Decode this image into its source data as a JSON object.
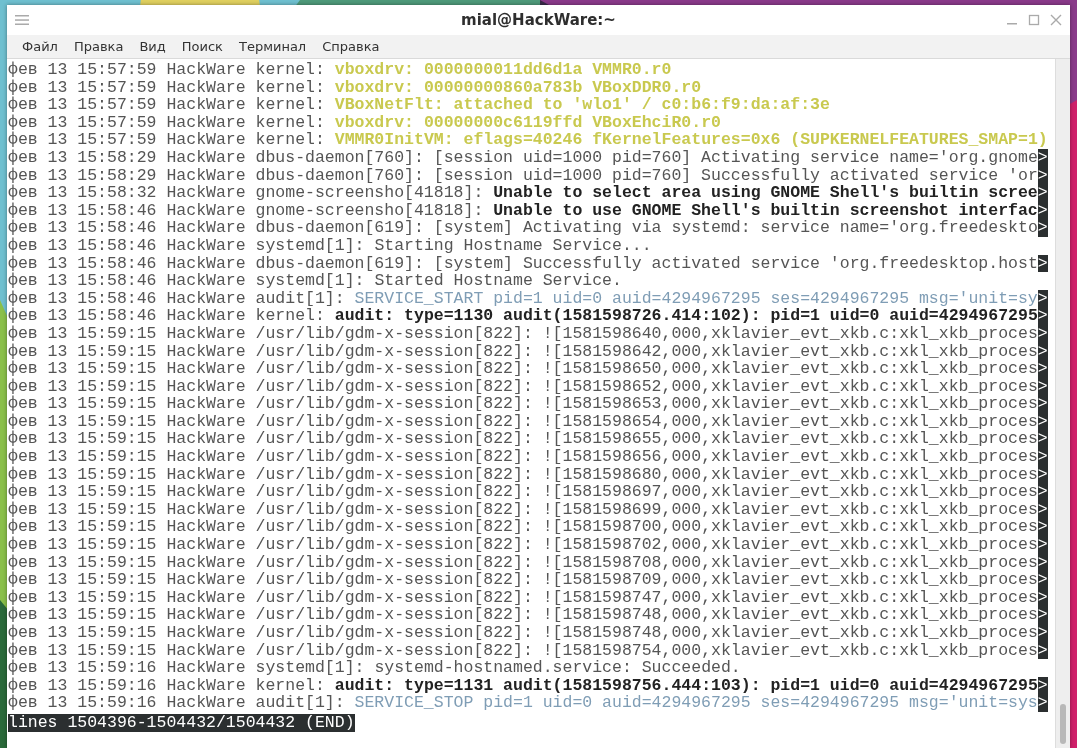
{
  "window": {
    "title": "mial@HackWare:~"
  },
  "menu": [
    "Файл",
    "Правка",
    "Вид",
    "Поиск",
    "Терминал",
    "Справка"
  ],
  "log": [
    {
      "prefix": "фев 13 15:57:59 HackWare kernel:",
      "message": "vboxdrv: 0000000011dd6d1a VMMR0.r0",
      "kind": "highlight"
    },
    {
      "prefix": "фев 13 15:57:59 HackWare kernel:",
      "message": "vboxdrv: 00000000860a783b VBoxDDR0.r0",
      "kind": "highlight"
    },
    {
      "prefix": "фев 13 15:57:59 HackWare kernel:",
      "message": "VBoxNetFlt: attached to 'wlo1' / c0:b6:f9:da:af:3e",
      "kind": "highlight"
    },
    {
      "prefix": "фев 13 15:57:59 HackWare kernel:",
      "message": "vboxdrv: 00000000c6119ffd VBoxEhciR0.r0",
      "kind": "highlight"
    },
    {
      "prefix": "фев 13 15:57:59 HackWare kernel:",
      "message": "VMMR0InitVM: eflags=40246 fKernelFeatures=0x6 (SUPKERNELFEATURES_SMAP=1)",
      "kind": "highlight"
    },
    {
      "prefix": "фев 13 15:58:29 HackWare dbus-daemon[760]:",
      "message": "[session uid=1000 pid=760] Activating service name='org.gnome",
      "kind": "plain",
      "more": ">"
    },
    {
      "prefix": "фев 13 15:58:29 HackWare dbus-daemon[760]:",
      "message": "[session uid=1000 pid=760] Successfully activated service 'or",
      "kind": "plain",
      "more": ">"
    },
    {
      "prefix": "фев 13 15:58:32 HackWare gnome-screensho[41818]:",
      "message": "Unable to select area using GNOME Shell's builtin scree",
      "kind": "bold",
      "more": ">"
    },
    {
      "prefix": "фев 13 15:58:46 HackWare gnome-screensho[41818]:",
      "message": "Unable to use GNOME Shell's builtin screenshot interfac",
      "kind": "bold",
      "more": ">"
    },
    {
      "prefix": "фев 13 15:58:46 HackWare dbus-daemon[619]:",
      "message": "[system] Activating via systemd: service name='org.freedeskto",
      "kind": "plain",
      "more": ">"
    },
    {
      "prefix": "фев 13 15:58:46 HackWare systemd[1]:",
      "message": "Starting Hostname Service...",
      "kind": "plain"
    },
    {
      "prefix": "фев 13 15:58:46 HackWare dbus-daemon[619]:",
      "message": "[system] Successfully activated service 'org.freedesktop.host",
      "kind": "plain",
      "more": ">"
    },
    {
      "prefix": "фев 13 15:58:46 HackWare systemd[1]:",
      "message": "Started Hostname Service.",
      "kind": "plain"
    },
    {
      "prefix": "фев 13 15:58:46 HackWare audit[1]:",
      "message": "SERVICE_START pid=1 uid=0 auid=4294967295 ses=4294967295 msg='unit=sy",
      "kind": "notice",
      "more": ">"
    },
    {
      "prefix": "фев 13 15:58:46 HackWare kernel:",
      "message": "audit: type=1130 audit(1581598726.414:102): pid=1 uid=0 auid=4294967295",
      "kind": "bold",
      "more": ">"
    },
    {
      "prefix": "фев 13 15:59:15 HackWare /usr/lib/gdm-x-session[822]:",
      "message": "![1581598640,000,xklavier_evt_xkb.c:xkl_xkb_proces",
      "kind": "plain",
      "more": ">"
    },
    {
      "prefix": "фев 13 15:59:15 HackWare /usr/lib/gdm-x-session[822]:",
      "message": "![1581598642,000,xklavier_evt_xkb.c:xkl_xkb_proces",
      "kind": "plain",
      "more": ">"
    },
    {
      "prefix": "фев 13 15:59:15 HackWare /usr/lib/gdm-x-session[822]:",
      "message": "![1581598650,000,xklavier_evt_xkb.c:xkl_xkb_proces",
      "kind": "plain",
      "more": ">"
    },
    {
      "prefix": "фев 13 15:59:15 HackWare /usr/lib/gdm-x-session[822]:",
      "message": "![1581598652,000,xklavier_evt_xkb.c:xkl_xkb_proces",
      "kind": "plain",
      "more": ">"
    },
    {
      "prefix": "фев 13 15:59:15 HackWare /usr/lib/gdm-x-session[822]:",
      "message": "![1581598653,000,xklavier_evt_xkb.c:xkl_xkb_proces",
      "kind": "plain",
      "more": ">"
    },
    {
      "prefix": "фев 13 15:59:15 HackWare /usr/lib/gdm-x-session[822]:",
      "message": "![1581598654,000,xklavier_evt_xkb.c:xkl_xkb_proces",
      "kind": "plain",
      "more": ">"
    },
    {
      "prefix": "фев 13 15:59:15 HackWare /usr/lib/gdm-x-session[822]:",
      "message": "![1581598655,000,xklavier_evt_xkb.c:xkl_xkb_proces",
      "kind": "plain",
      "more": ">"
    },
    {
      "prefix": "фев 13 15:59:15 HackWare /usr/lib/gdm-x-session[822]:",
      "message": "![1581598656,000,xklavier_evt_xkb.c:xkl_xkb_proces",
      "kind": "plain",
      "more": ">"
    },
    {
      "prefix": "фев 13 15:59:15 HackWare /usr/lib/gdm-x-session[822]:",
      "message": "![1581598680,000,xklavier_evt_xkb.c:xkl_xkb_proces",
      "kind": "plain",
      "more": ">"
    },
    {
      "prefix": "фев 13 15:59:15 HackWare /usr/lib/gdm-x-session[822]:",
      "message": "![1581598697,000,xklavier_evt_xkb.c:xkl_xkb_proces",
      "kind": "plain",
      "more": ">"
    },
    {
      "prefix": "фев 13 15:59:15 HackWare /usr/lib/gdm-x-session[822]:",
      "message": "![1581598699,000,xklavier_evt_xkb.c:xkl_xkb_proces",
      "kind": "plain",
      "more": ">"
    },
    {
      "prefix": "фев 13 15:59:15 HackWare /usr/lib/gdm-x-session[822]:",
      "message": "![1581598700,000,xklavier_evt_xkb.c:xkl_xkb_proces",
      "kind": "plain",
      "more": ">"
    },
    {
      "prefix": "фев 13 15:59:15 HackWare /usr/lib/gdm-x-session[822]:",
      "message": "![1581598702,000,xklavier_evt_xkb.c:xkl_xkb_proces",
      "kind": "plain",
      "more": ">"
    },
    {
      "prefix": "фев 13 15:59:15 HackWare /usr/lib/gdm-x-session[822]:",
      "message": "![1581598708,000,xklavier_evt_xkb.c:xkl_xkb_proces",
      "kind": "plain",
      "more": ">"
    },
    {
      "prefix": "фев 13 15:59:15 HackWare /usr/lib/gdm-x-session[822]:",
      "message": "![1581598709,000,xklavier_evt_xkb.c:xkl_xkb_proces",
      "kind": "plain",
      "more": ">"
    },
    {
      "prefix": "фев 13 15:59:15 HackWare /usr/lib/gdm-x-session[822]:",
      "message": "![1581598747,000,xklavier_evt_xkb.c:xkl_xkb_proces",
      "kind": "plain",
      "more": ">"
    },
    {
      "prefix": "фев 13 15:59:15 HackWare /usr/lib/gdm-x-session[822]:",
      "message": "![1581598748,000,xklavier_evt_xkb.c:xkl_xkb_proces",
      "kind": "plain",
      "more": ">"
    },
    {
      "prefix": "фев 13 15:59:15 HackWare /usr/lib/gdm-x-session[822]:",
      "message": "![1581598748,000,xklavier_evt_xkb.c:xkl_xkb_proces",
      "kind": "plain",
      "more": ">"
    },
    {
      "prefix": "фев 13 15:59:15 HackWare /usr/lib/gdm-x-session[822]:",
      "message": "![1581598754,000,xklavier_evt_xkb.c:xkl_xkb_proces",
      "kind": "plain",
      "more": ">"
    },
    {
      "prefix": "фев 13 15:59:16 HackWare systemd[1]:",
      "message": "systemd-hostnamed.service: Succeeded.",
      "kind": "plain"
    },
    {
      "prefix": "фев 13 15:59:16 HackWare kernel:",
      "message": "audit: type=1131 audit(1581598756.444:103): pid=1 uid=0 auid=4294967295",
      "kind": "bold",
      "more": ">"
    },
    {
      "prefix": "фев 13 15:59:16 HackWare audit[1]:",
      "message": "SERVICE_STOP pid=1 uid=0 auid=4294967295 ses=4294967295 msg='unit=sys",
      "kind": "notice",
      "more": ">"
    }
  ],
  "pager_status": "lines 1504396-1504432/1504432 (END)"
}
